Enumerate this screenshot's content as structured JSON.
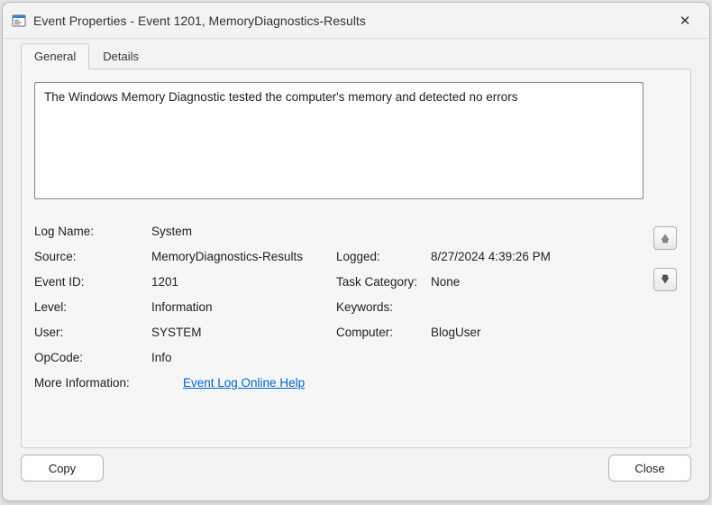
{
  "window": {
    "title": "Event Properties - Event 1201, MemoryDiagnostics-Results"
  },
  "tabs": {
    "general": "General",
    "details": "Details"
  },
  "description": "The Windows Memory Diagnostic tested the computer's memory and detected no errors",
  "props": {
    "labels": {
      "logName": "Log Name:",
      "source": "Source:",
      "eventId": "Event ID:",
      "level": "Level:",
      "user": "User:",
      "opcode": "OpCode:",
      "moreInfo": "More Information:",
      "logged": "Logged:",
      "taskCategory": "Task Category:",
      "keywords": "Keywords:",
      "computer": "Computer:"
    },
    "values": {
      "logName": "System",
      "source": "MemoryDiagnostics-Results",
      "eventId": "1201",
      "level": "Information",
      "user": "SYSTEM",
      "opcode": "Info",
      "moreInfoLink": "Event Log Online Help",
      "logged": "8/27/2024 4:39:26 PM",
      "taskCategory": "None",
      "keywords": "",
      "computer": "BlogUser"
    }
  },
  "buttons": {
    "copy": "Copy",
    "close": "Close"
  }
}
